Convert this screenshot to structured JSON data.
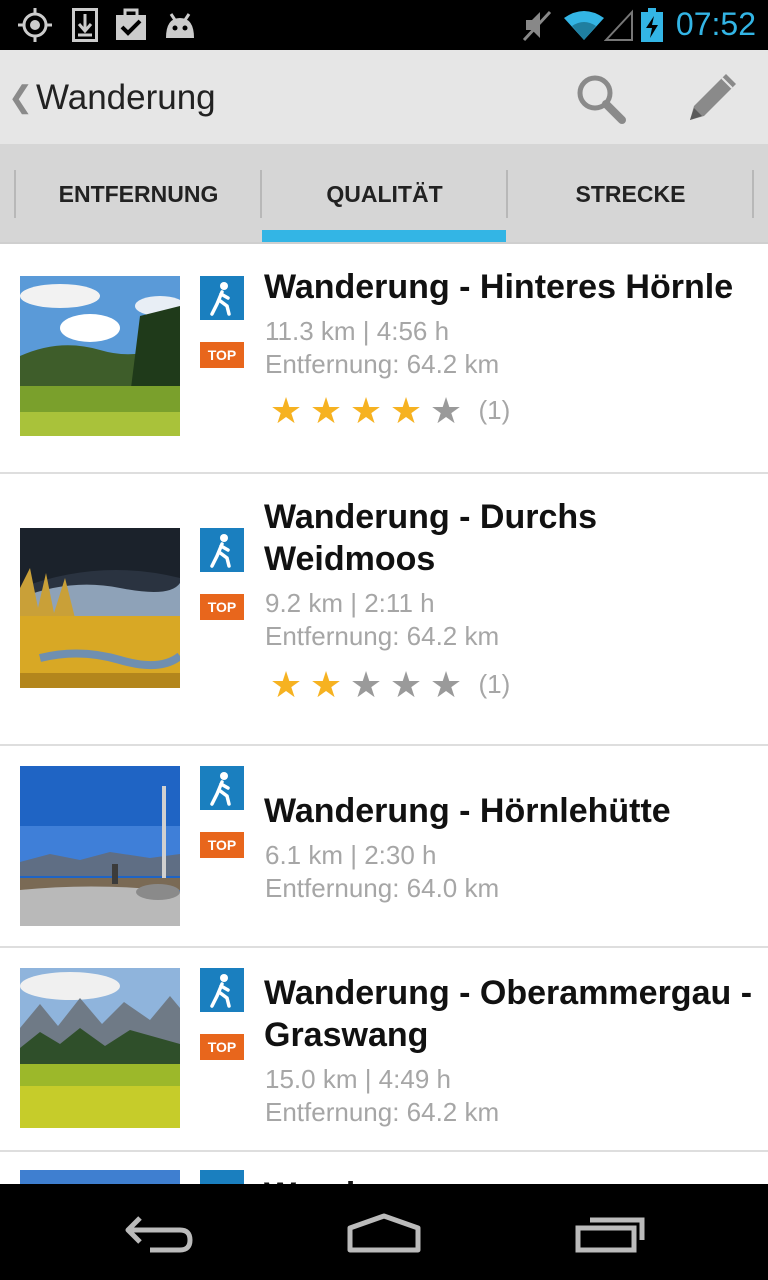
{
  "status_bar": {
    "time": "07:52",
    "icons": [
      "gps-icon",
      "download-icon",
      "task-done-icon",
      "android-icon",
      "mute-icon",
      "wifi-icon",
      "signal-icon",
      "battery-charging-icon"
    ]
  },
  "action_bar": {
    "title": "Wanderung",
    "up_icon": "chevron-left-icon",
    "actions": [
      "search-icon",
      "pencil-icon"
    ]
  },
  "tabs": [
    {
      "label": "ENTFERNUNG",
      "selected": false
    },
    {
      "label": "QUALITÄT",
      "selected": true
    },
    {
      "label": "STRECKE",
      "selected": false
    }
  ],
  "colors": {
    "accent": "#33b5e5",
    "hike_icon": "#1a7fbf",
    "top_badge": "#e8661c",
    "star": "#f6b221"
  },
  "tours": [
    {
      "title": "Wanderung - Hinteres Hörnle",
      "stats": "11.3 km | 4:56 h",
      "distance": "Entfernung:  64.2 km",
      "badge": "TOP",
      "rating": 4,
      "rating_count": "(1)"
    },
    {
      "title": "Wanderung - Durchs Weidmoos",
      "stats": "9.2 km | 2:11 h",
      "distance": "Entfernung:  64.2 km",
      "badge": "TOP",
      "rating": 2,
      "rating_count": "(1)"
    },
    {
      "title": "Wanderung - Hörnlehütte",
      "stats": "6.1 km | 2:30 h",
      "distance": "Entfernung:  64.0 km",
      "badge": "TOP"
    },
    {
      "title": "Wanderung - Oberammergau - Graswang",
      "stats": "15.0 km | 4:49 h",
      "distance": "Entfernung:  64.2 km",
      "badge": "TOP"
    },
    {
      "title": "Wanderung",
      "stats": "",
      "distance": "",
      "badge": ""
    }
  ],
  "nav_bar": [
    "back-icon",
    "home-icon",
    "recent-apps-icon"
  ]
}
